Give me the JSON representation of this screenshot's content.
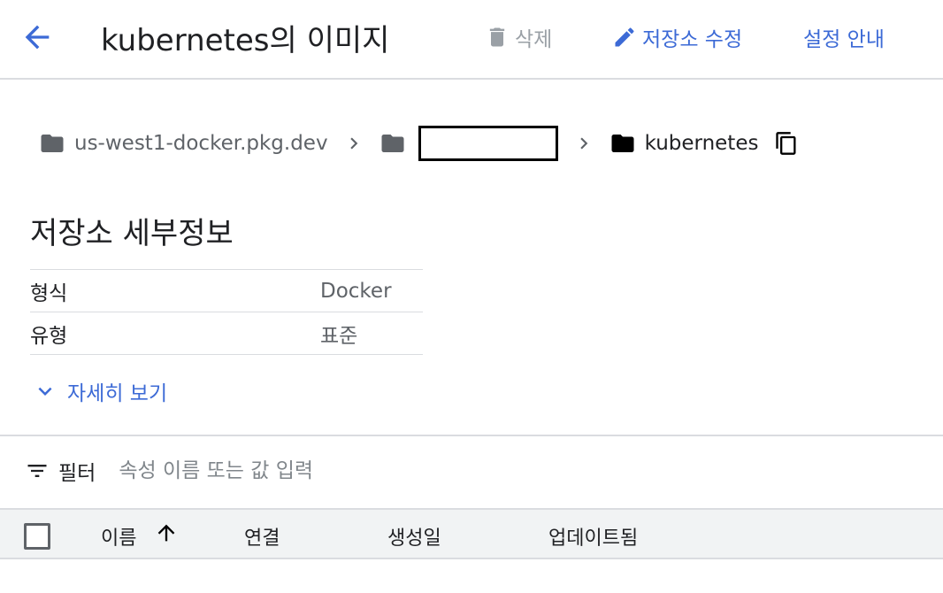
{
  "header": {
    "title": "kubernetes의 이미지",
    "delete_label": "삭제",
    "edit_label": "저장소 수정",
    "guide_label": "설정 안내",
    "back_icon": "arrow-back-icon",
    "delete_icon": "trash-icon",
    "edit_icon": "pencil-icon"
  },
  "breadcrumb": {
    "host": "us-west1-docker.pkg.dev",
    "project": "",
    "repository": "kubernetes",
    "folder_icon": "folder-icon",
    "copy_icon": "copy-icon"
  },
  "details": {
    "title": "저장소 세부정보",
    "rows": [
      {
        "key": "형식",
        "value": "Docker"
      },
      {
        "key": "유형",
        "value": "표준"
      }
    ],
    "more_label": "자세히 보기"
  },
  "filter": {
    "label": "필터",
    "placeholder": "속성 이름 또는 값 입력"
  },
  "table": {
    "columns": [
      "이름",
      "연결",
      "생성일",
      "업데이트됨"
    ]
  },
  "colors": {
    "accent": "#3c6ad6",
    "muted": "#5f6368",
    "disabled": "#9aa0a6",
    "divider": "#dadce0"
  }
}
